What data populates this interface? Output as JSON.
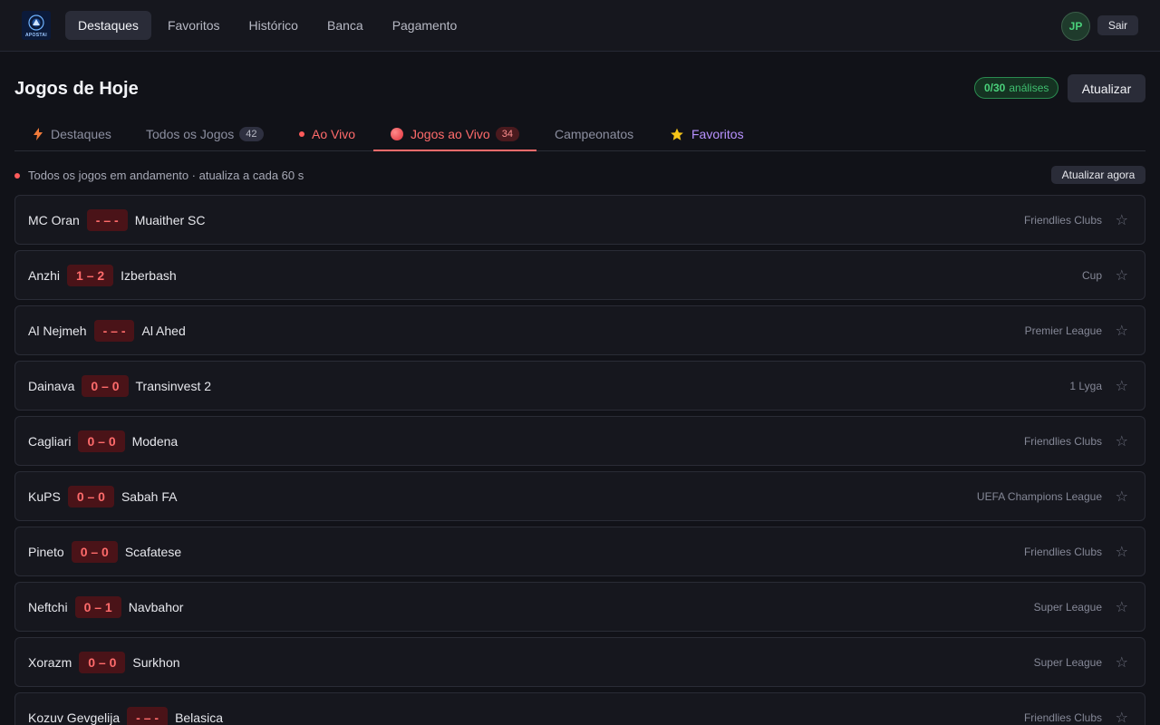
{
  "app": {
    "logo_text": "APOSTAI"
  },
  "nav": {
    "items": [
      {
        "label": "Destaques",
        "active": true
      },
      {
        "label": "Favoritos",
        "active": false
      },
      {
        "label": "Histórico",
        "active": false
      },
      {
        "label": "Banca",
        "active": false
      },
      {
        "label": "Pagamento",
        "active": false
      }
    ]
  },
  "user": {
    "initials": "JP",
    "logout_label": "Sair"
  },
  "header": {
    "title": "Jogos de Hoje",
    "analyses_count": "0/30",
    "analyses_label": "análises",
    "refresh_label": "Atualizar"
  },
  "tabs": {
    "highlights": "Destaques",
    "all_games": "Todos os Jogos",
    "all_games_count": "42",
    "live": "Ao Vivo",
    "live_games": "Jogos ao Vivo",
    "live_games_count": "34",
    "championships": "Campeonatos",
    "favorites": "Favoritos"
  },
  "status": {
    "text": "Todos os jogos em andamento · atualiza a cada 60 s",
    "refresh_now": "Atualizar agora"
  },
  "matches": [
    {
      "home": "MC Oran",
      "score": "- – -",
      "away": "Muaither SC",
      "league": "Friendlies Clubs"
    },
    {
      "home": "Anzhi",
      "score": "1 – 2",
      "away": "Izberbash",
      "league": "Cup"
    },
    {
      "home": "Al Nejmeh",
      "score": "- – -",
      "away": "Al Ahed",
      "league": "Premier League"
    },
    {
      "home": "Dainava",
      "score": "0 – 0",
      "away": "Transinvest 2",
      "league": "1 Lyga"
    },
    {
      "home": "Cagliari",
      "score": "0 – 0",
      "away": "Modena",
      "league": "Friendlies Clubs"
    },
    {
      "home": "KuPS",
      "score": "0 – 0",
      "away": "Sabah FA",
      "league": "UEFA Champions League"
    },
    {
      "home": "Pineto",
      "score": "0 – 0",
      "away": "Scafatese",
      "league": "Friendlies Clubs"
    },
    {
      "home": "Neftchi",
      "score": "0 – 1",
      "away": "Navbahor",
      "league": "Super League"
    },
    {
      "home": "Xorazm",
      "score": "0 – 0",
      "away": "Surkhon",
      "league": "Super League"
    },
    {
      "home": "Kozuv Gevgelija",
      "score": "- – -",
      "away": "Belasica",
      "league": "Friendlies Clubs"
    }
  ],
  "icons": {
    "star": "star-icon",
    "bolt": "lightning-icon",
    "live": "live-dot-icon"
  },
  "colors": {
    "accent_red": "#ff6b6b",
    "accent_green": "#4ad17b",
    "accent_purple": "#b892ff"
  }
}
